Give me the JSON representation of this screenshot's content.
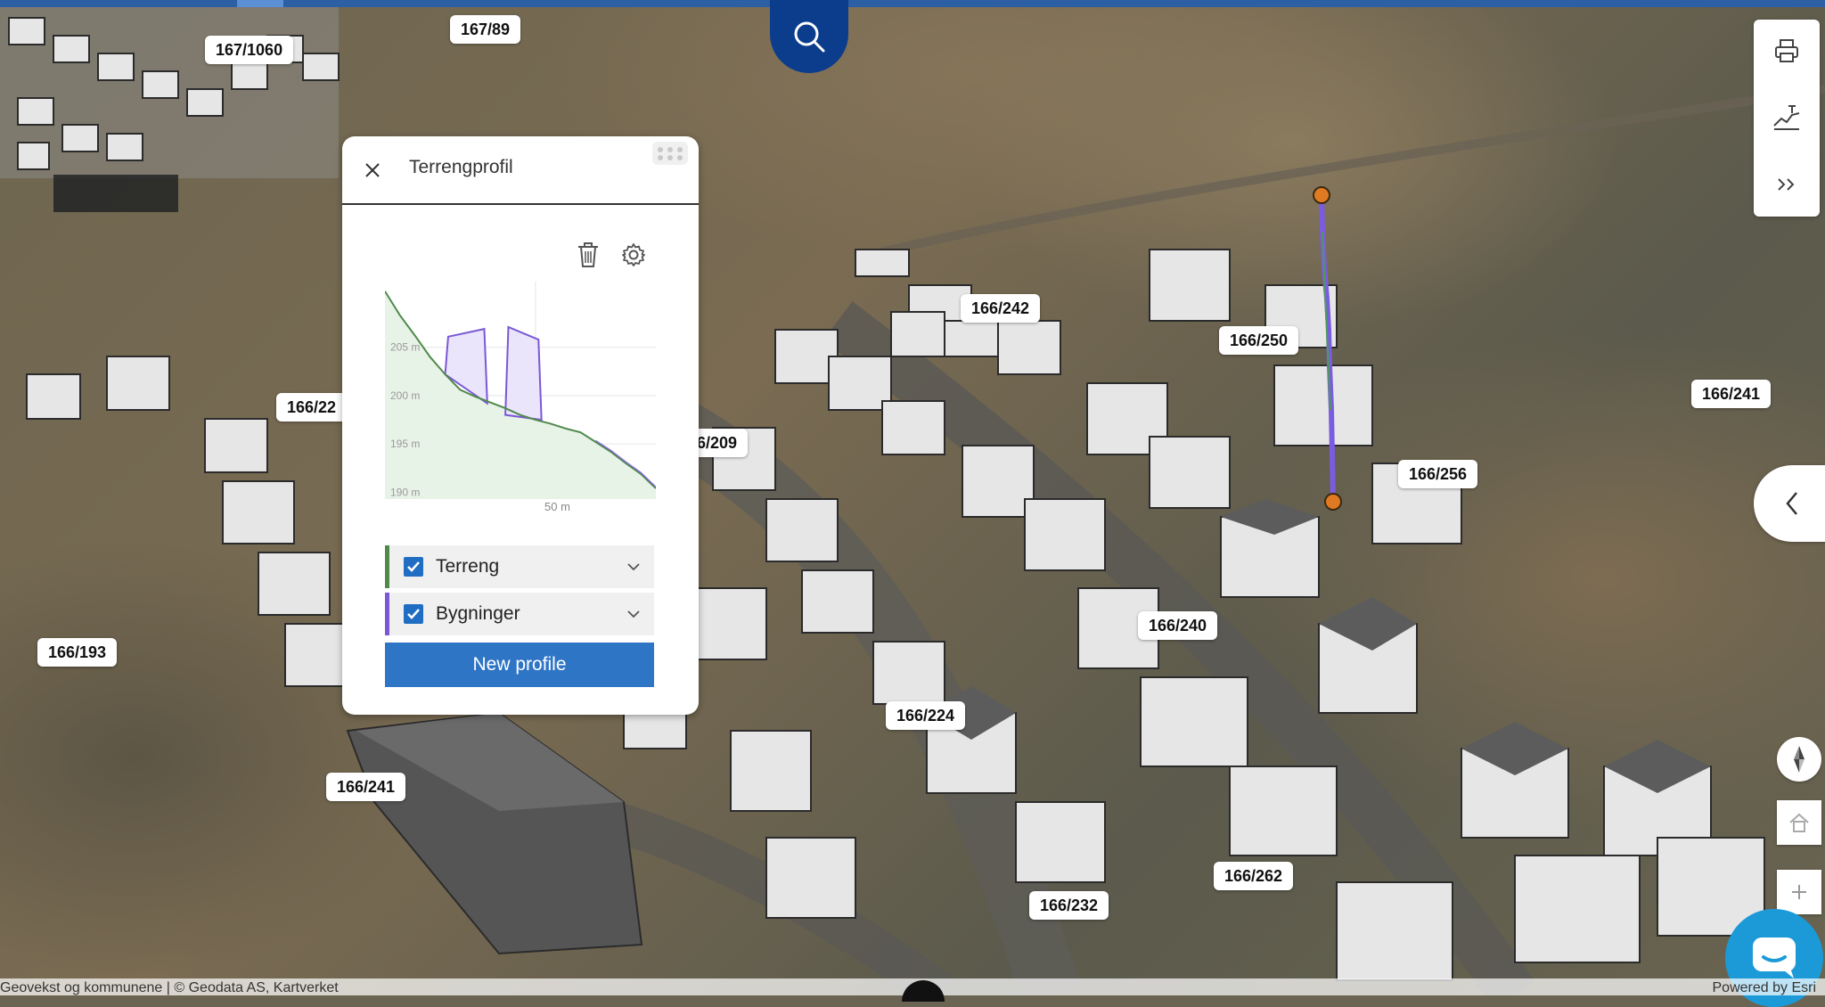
{
  "panel": {
    "title": "Terrengprofil",
    "new_profile_label": "New profile",
    "layers": [
      {
        "label": "Terreng",
        "checked": true,
        "color": "#4f8a4b"
      },
      {
        "label": "Bygninger",
        "checked": true,
        "color": "#7a58d6"
      }
    ],
    "chart_ticks": [
      "205 m",
      "200 m",
      "195 m",
      "190 m"
    ],
    "chart_xtick": "50 m"
  },
  "chart_data": {
    "type": "area",
    "x_tick_label": "50 m",
    "y_tick_labels": [
      "205 m",
      "200 m",
      "195 m",
      "190 m"
    ],
    "series": [
      {
        "name": "Terreng",
        "color": "#4f8a4b",
        "x": [
          0,
          5,
          10,
          15,
          20,
          25,
          30,
          35,
          40,
          45,
          50,
          55,
          60,
          65,
          70,
          75,
          80,
          85,
          90
        ],
        "values": [
          210.8,
          208.3,
          206.2,
          204.0,
          202.2,
          200.6,
          199.9,
          199.3,
          198.7,
          198.0,
          197.5,
          197.1,
          196.6,
          196.2,
          195.2,
          194.2,
          193.0,
          191.9,
          190.4
        ]
      },
      {
        "name": "Bygninger",
        "color": "#7a58d6",
        "x": [
          20,
          21,
          33,
          34,
          40,
          41,
          51,
          52
        ],
        "values": [
          202.2,
          206.1,
          206.9,
          199.2,
          198.0,
          207.1,
          205.8,
          197.5
        ]
      }
    ]
  },
  "parcels": [
    "167/1060",
    "167/89",
    "166/242",
    "166/250",
    "166/241",
    "166/22",
    "6/209",
    "166/256",
    "166/240",
    "166/193",
    "166/224",
    "166/241",
    "166/262",
    "166/232"
  ],
  "attribution": {
    "left": "Geovekst og kommunene | © Geodata AS, Kartverket",
    "right": "Powered by Esri"
  },
  "toolbar": {
    "icons": [
      "print-icon",
      "elevation-profile-icon",
      "expand-icon"
    ]
  },
  "colors": {
    "accent": "#2f75c6",
    "search_bg": "#0c3c8c",
    "profile_line": "#7a58d6",
    "marker": "#e07a22"
  }
}
